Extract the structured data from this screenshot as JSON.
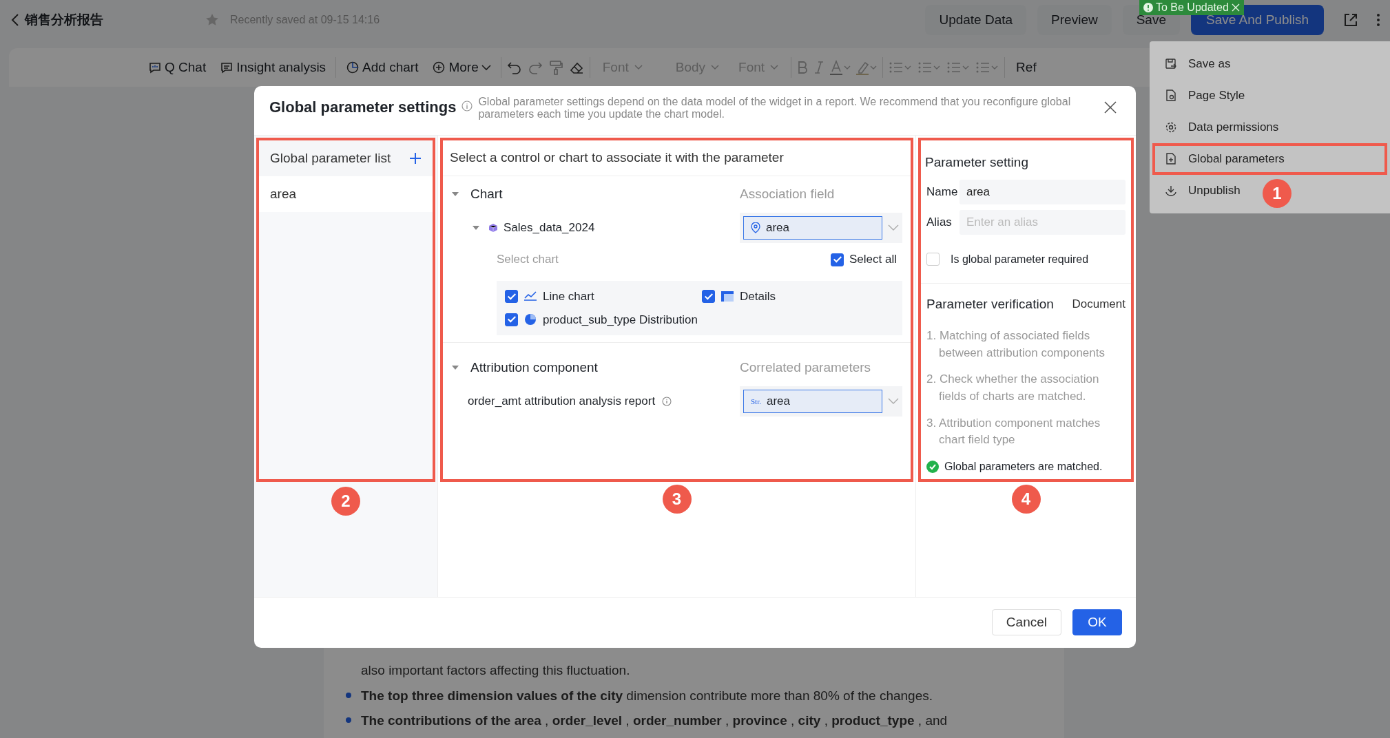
{
  "header": {
    "title": "销售分析报告",
    "starred": false,
    "save_status": "Recently saved at 09-15 14:16",
    "badge": "To Be Updated",
    "buttons": [
      {
        "label": "Update Data",
        "kind": "default"
      },
      {
        "label": "Preview",
        "kind": "default"
      },
      {
        "label": "Save",
        "kind": "default"
      },
      {
        "label": "Save And Publish",
        "kind": "primary"
      }
    ]
  },
  "toolbar": {
    "items": [
      {
        "label": "Q Chat",
        "kind": "chat"
      },
      {
        "label": "Insight analysis",
        "kind": "insight"
      },
      {
        "label": "Add chart",
        "kind": "chart"
      },
      {
        "label": "More",
        "kind": "more"
      }
    ],
    "selects": [
      "Font",
      "Body",
      "Font"
    ],
    "overflow": "Ref"
  },
  "menu": {
    "items": [
      {
        "label": "Save as",
        "kind": "save",
        "highlighted": false
      },
      {
        "label": "Page Style",
        "kind": "style",
        "highlighted": false
      },
      {
        "label": "Data permissions",
        "kind": "gear",
        "highlighted": false
      },
      {
        "label": "Global parameters",
        "kind": "param",
        "highlighted": true
      },
      {
        "label": "Unpublish",
        "kind": "download",
        "highlighted": false
      }
    ]
  },
  "document": {
    "lines": [
      {
        "kind": "continuation",
        "text": "also important factors affecting this fluctuation."
      },
      {
        "kind": "bullet",
        "text": "**The top three dimension values of the city** dimension contribute more than 80% of the changes."
      },
      {
        "kind": "bullet",
        "text": "**The contributions of the area** , **order_level** , **order_number** , **province** , **city** , **product_type** , and"
      }
    ]
  },
  "dialog": {
    "title": "Global parameter settings",
    "description": "Global parameter settings depend on the data model of the widget in a report. We recommend that you reconfigure global parameters each time you update the chart model.",
    "parameter_list": {
      "title": "Global parameter list",
      "items": [
        {
          "label": "area",
          "selected": true
        }
      ]
    },
    "association": {
      "title": "Select a control or chart to associate it with the parameter",
      "chart_section": {
        "title": "Chart",
        "expanded": true,
        "field_label": "Association field",
        "dataset": "Sales_data_2024",
        "field_value": "area",
        "select_chart_label": "Select chart",
        "select_all": {
          "label": "Select all",
          "checked": true
        },
        "charts": [
          {
            "label": "Line chart",
            "kind": "line",
            "checked": true
          },
          {
            "label": "Details",
            "kind": "table",
            "checked": true
          },
          {
            "label": "product_sub_type Distribution",
            "kind": "pie",
            "checked": true
          }
        ]
      },
      "attribution_section": {
        "title": "Attribution component",
        "expanded": true,
        "field_label": "Correlated parameters",
        "component": "order_amt attribution analysis report",
        "type_tag": "Str.",
        "field_value": "area"
      }
    },
    "settings": {
      "title": "Parameter setting",
      "name_label": "Name",
      "name_value": "area",
      "alias_label": "Alias",
      "alias_placeholder": "Enter an alias",
      "required": {
        "label": "Is global parameter required",
        "checked": false
      },
      "verification_title": "Parameter verification",
      "document_link": "Document",
      "checks": [
        "1. Matching of associated fields between attribution components",
        "2. Check whether the association fields of charts are matched.",
        "3. Attribution component matches chart field type"
      ],
      "result": "Global parameters are matched."
    },
    "buttons": [
      {
        "label": "Cancel",
        "kind": "default"
      },
      {
        "label": "OK",
        "kind": "primary"
      }
    ]
  },
  "annotations": [
    {
      "number": "1"
    },
    {
      "number": "2"
    },
    {
      "number": "3"
    },
    {
      "number": "4"
    }
  ]
}
